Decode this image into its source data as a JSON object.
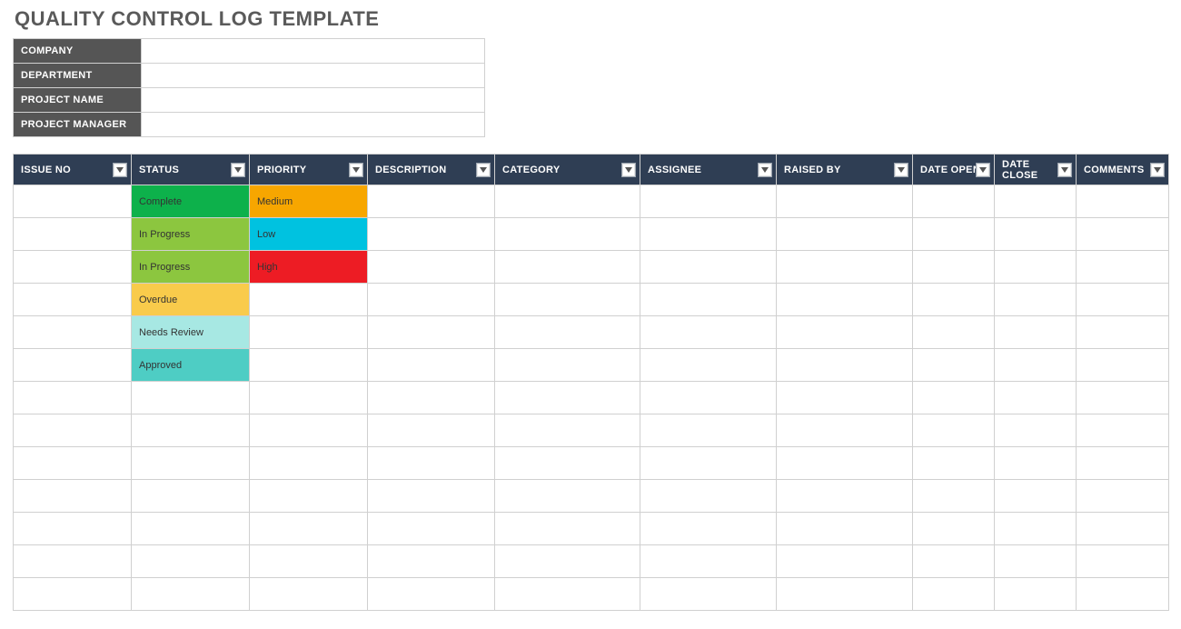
{
  "title": "QUALITY CONTROL LOG TEMPLATE",
  "meta_labels": {
    "company": "COMPANY",
    "department": "DEPARTMENT",
    "project_name": "PROJECT NAME",
    "project_manager": "PROJECT MANAGER"
  },
  "meta_values": {
    "company": "",
    "department": "",
    "project_name": "",
    "project_manager": ""
  },
  "columns": [
    {
      "key": "issue_no",
      "label": "ISSUE NO",
      "class": "c-issue"
    },
    {
      "key": "status",
      "label": "STATUS",
      "class": "c-status"
    },
    {
      "key": "priority",
      "label": "PRIORITY",
      "class": "c-priority"
    },
    {
      "key": "description",
      "label": "DESCRIPTION",
      "class": "c-desc"
    },
    {
      "key": "category",
      "label": "CATEGORY",
      "class": "c-category"
    },
    {
      "key": "assignee",
      "label": "ASSIGNEE",
      "class": "c-assignee"
    },
    {
      "key": "raised_by",
      "label": "RAISED BY",
      "class": "c-raised"
    },
    {
      "key": "date_open",
      "label": "DATE OPEN",
      "class": "c-dateopen"
    },
    {
      "key": "date_close",
      "label": "DATE CLOSE",
      "class": "c-dateclose"
    },
    {
      "key": "comments",
      "label": "COMMENTS",
      "class": "c-comments"
    }
  ],
  "status_colors": {
    "Complete": "#0DB14B",
    "In Progress": "#8CC63F",
    "Overdue": "#F9CB4B",
    "Needs Review": "#A7E8E3",
    "Approved": "#4ECDC4"
  },
  "priority_colors": {
    "Medium": "#F7A600",
    "Low": "#00C2E0",
    "High": "#ED1C24"
  },
  "rows": [
    {
      "issue_no": "",
      "status": "Complete",
      "priority": "Medium",
      "description": "",
      "category": "",
      "assignee": "",
      "raised_by": "",
      "date_open": "",
      "date_close": "",
      "comments": ""
    },
    {
      "issue_no": "",
      "status": "In Progress",
      "priority": "Low",
      "description": "",
      "category": "",
      "assignee": "",
      "raised_by": "",
      "date_open": "",
      "date_close": "",
      "comments": ""
    },
    {
      "issue_no": "",
      "status": "In Progress",
      "priority": "High",
      "description": "",
      "category": "",
      "assignee": "",
      "raised_by": "",
      "date_open": "",
      "date_close": "",
      "comments": ""
    },
    {
      "issue_no": "",
      "status": "Overdue",
      "priority": "",
      "description": "",
      "category": "",
      "assignee": "",
      "raised_by": "",
      "date_open": "",
      "date_close": "",
      "comments": ""
    },
    {
      "issue_no": "",
      "status": "Needs Review",
      "priority": "",
      "description": "",
      "category": "",
      "assignee": "",
      "raised_by": "",
      "date_open": "",
      "date_close": "",
      "comments": ""
    },
    {
      "issue_no": "",
      "status": "Approved",
      "priority": "",
      "description": "",
      "category": "",
      "assignee": "",
      "raised_by": "",
      "date_open": "",
      "date_close": "",
      "comments": ""
    },
    {
      "issue_no": "",
      "status": "",
      "priority": "",
      "description": "",
      "category": "",
      "assignee": "",
      "raised_by": "",
      "date_open": "",
      "date_close": "",
      "comments": ""
    },
    {
      "issue_no": "",
      "status": "",
      "priority": "",
      "description": "",
      "category": "",
      "assignee": "",
      "raised_by": "",
      "date_open": "",
      "date_close": "",
      "comments": ""
    },
    {
      "issue_no": "",
      "status": "",
      "priority": "",
      "description": "",
      "category": "",
      "assignee": "",
      "raised_by": "",
      "date_open": "",
      "date_close": "",
      "comments": ""
    },
    {
      "issue_no": "",
      "status": "",
      "priority": "",
      "description": "",
      "category": "",
      "assignee": "",
      "raised_by": "",
      "date_open": "",
      "date_close": "",
      "comments": ""
    },
    {
      "issue_no": "",
      "status": "",
      "priority": "",
      "description": "",
      "category": "",
      "assignee": "",
      "raised_by": "",
      "date_open": "",
      "date_close": "",
      "comments": ""
    },
    {
      "issue_no": "",
      "status": "",
      "priority": "",
      "description": "",
      "category": "",
      "assignee": "",
      "raised_by": "",
      "date_open": "",
      "date_close": "",
      "comments": ""
    },
    {
      "issue_no": "",
      "status": "",
      "priority": "",
      "description": "",
      "category": "",
      "assignee": "",
      "raised_by": "",
      "date_open": "",
      "date_close": "",
      "comments": ""
    }
  ]
}
